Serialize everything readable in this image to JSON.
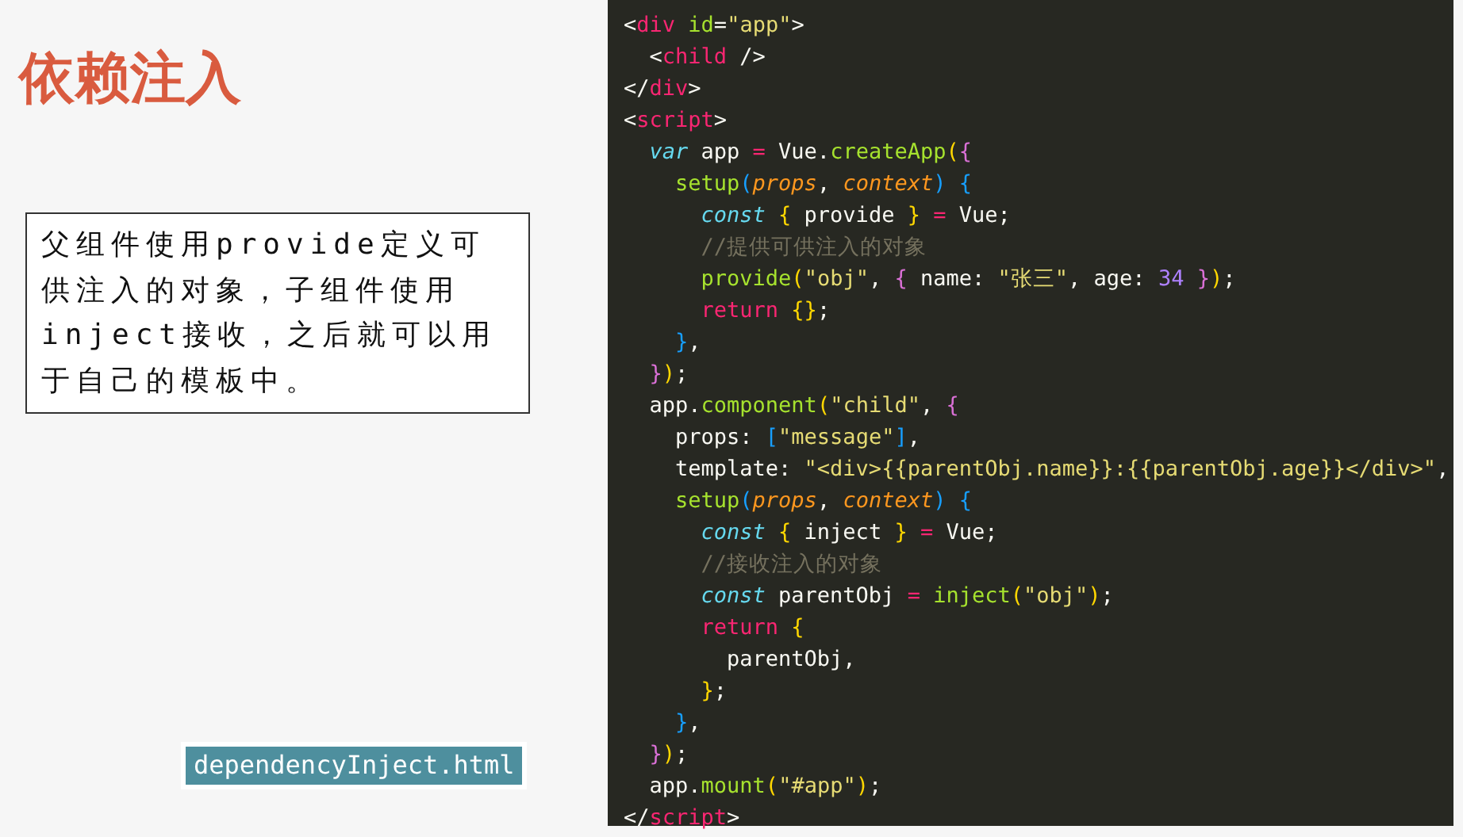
{
  "slide": {
    "title": "依赖注入",
    "description": "父组件使用provide定义可供注入的对象，子组件使用inject接收，之后就可以用于自己的模板中。",
    "file_label": "dependencyInject.html"
  },
  "code_lines": [
    [
      {
        "text": "<",
        "kind": "plain"
      },
      {
        "text": "div",
        "kind": "tag"
      },
      {
        "text": " id",
        "kind": "attr"
      },
      {
        "text": "=",
        "kind": "plain"
      },
      {
        "text": "\"app\"",
        "kind": "string"
      },
      {
        "text": ">",
        "kind": "plain"
      }
    ],
    [
      {
        "text": "  <",
        "kind": "plain"
      },
      {
        "text": "child",
        "kind": "tag"
      },
      {
        "text": " />",
        "kind": "plain"
      }
    ],
    [
      {
        "text": "</",
        "kind": "plain"
      },
      {
        "text": "div",
        "kind": "tag"
      },
      {
        "text": ">",
        "kind": "plain"
      }
    ],
    [
      {
        "text": "<",
        "kind": "plain"
      },
      {
        "text": "script",
        "kind": "tag"
      },
      {
        "text": ">",
        "kind": "plain"
      }
    ],
    [
      {
        "text": "  var",
        "kind": "storage"
      },
      {
        "text": " app ",
        "kind": "plain"
      },
      {
        "text": "=",
        "kind": "operator"
      },
      {
        "text": " Vue.",
        "kind": "plain"
      },
      {
        "text": "createApp",
        "kind": "function"
      },
      {
        "text": "(",
        "kind": "bracket1"
      },
      {
        "text": "{",
        "kind": "bracket2"
      }
    ],
    [
      {
        "text": "    setup",
        "kind": "function"
      },
      {
        "text": "(",
        "kind": "bracket3"
      },
      {
        "text": "props",
        "kind": "param"
      },
      {
        "text": ", ",
        "kind": "plain"
      },
      {
        "text": "context",
        "kind": "param"
      },
      {
        "text": ")",
        "kind": "bracket3"
      },
      {
        "text": " {",
        "kind": "bracket3"
      }
    ],
    [
      {
        "text": "      const",
        "kind": "storage"
      },
      {
        "text": " {",
        "kind": "bracket1"
      },
      {
        "text": " provide ",
        "kind": "plain"
      },
      {
        "text": "}",
        "kind": "bracket1"
      },
      {
        "text": " =",
        "kind": "operator"
      },
      {
        "text": " Vue;",
        "kind": "plain"
      }
    ],
    [
      {
        "text": "      //提供可供注入的对象",
        "kind": "comment"
      }
    ],
    [
      {
        "text": "      provide",
        "kind": "function"
      },
      {
        "text": "(",
        "kind": "bracket1"
      },
      {
        "text": "\"obj\"",
        "kind": "string"
      },
      {
        "text": ", ",
        "kind": "plain"
      },
      {
        "text": "{",
        "kind": "bracket2"
      },
      {
        "text": " name: ",
        "kind": "plain"
      },
      {
        "text": "\"张三\"",
        "kind": "string"
      },
      {
        "text": ", age: ",
        "kind": "plain"
      },
      {
        "text": "34",
        "kind": "number"
      },
      {
        "text": " }",
        "kind": "bracket2"
      },
      {
        "text": ")",
        "kind": "bracket1"
      },
      {
        "text": ";",
        "kind": "plain"
      }
    ],
    [
      {
        "text": "      return",
        "kind": "operator"
      },
      {
        "text": " {}",
        "kind": "bracket1"
      },
      {
        "text": ";",
        "kind": "plain"
      }
    ],
    [
      {
        "text": "    }",
        "kind": "bracket3"
      },
      {
        "text": ",",
        "kind": "plain"
      }
    ],
    [
      {
        "text": "  }",
        "kind": "bracket2"
      },
      {
        "text": ")",
        "kind": "bracket1"
      },
      {
        "text": ";",
        "kind": "plain"
      }
    ],
    [
      {
        "text": "  app.",
        "kind": "plain"
      },
      {
        "text": "component",
        "kind": "function"
      },
      {
        "text": "(",
        "kind": "bracket1"
      },
      {
        "text": "\"child\"",
        "kind": "string"
      },
      {
        "text": ", ",
        "kind": "plain"
      },
      {
        "text": "{",
        "kind": "bracket2"
      }
    ],
    [
      {
        "text": "    props: ",
        "kind": "plain"
      },
      {
        "text": "[",
        "kind": "bracket3"
      },
      {
        "text": "\"message\"",
        "kind": "string"
      },
      {
        "text": "]",
        "kind": "bracket3"
      },
      {
        "text": ",",
        "kind": "plain"
      }
    ],
    [
      {
        "text": "    template: ",
        "kind": "plain"
      },
      {
        "text": "\"<div>{{parentObj.name}}:{{parentObj.age}}</div>\"",
        "kind": "string"
      },
      {
        "text": ",",
        "kind": "plain"
      }
    ],
    [
      {
        "text": "    setup",
        "kind": "function"
      },
      {
        "text": "(",
        "kind": "bracket3"
      },
      {
        "text": "props",
        "kind": "param"
      },
      {
        "text": ", ",
        "kind": "plain"
      },
      {
        "text": "context",
        "kind": "param"
      },
      {
        "text": ")",
        "kind": "bracket3"
      },
      {
        "text": " {",
        "kind": "bracket3"
      }
    ],
    [
      {
        "text": "      const",
        "kind": "storage"
      },
      {
        "text": " {",
        "kind": "bracket1"
      },
      {
        "text": " inject ",
        "kind": "plain"
      },
      {
        "text": "}",
        "kind": "bracket1"
      },
      {
        "text": " =",
        "kind": "operator"
      },
      {
        "text": " Vue;",
        "kind": "plain"
      }
    ],
    [
      {
        "text": "      //接收注入的对象",
        "kind": "comment"
      }
    ],
    [
      {
        "text": "      const",
        "kind": "storage"
      },
      {
        "text": " parentObj ",
        "kind": "plain"
      },
      {
        "text": "=",
        "kind": "operator"
      },
      {
        "text": " inject",
        "kind": "function"
      },
      {
        "text": "(",
        "kind": "bracket1"
      },
      {
        "text": "\"obj\"",
        "kind": "string"
      },
      {
        "text": ")",
        "kind": "bracket1"
      },
      {
        "text": ";",
        "kind": "plain"
      }
    ],
    [
      {
        "text": "      return",
        "kind": "operator"
      },
      {
        "text": " {",
        "kind": "bracket1"
      }
    ],
    [
      {
        "text": "        parentObj,",
        "kind": "plain"
      }
    ],
    [
      {
        "text": "      }",
        "kind": "bracket1"
      },
      {
        "text": ";",
        "kind": "plain"
      }
    ],
    [
      {
        "text": "    }",
        "kind": "bracket3"
      },
      {
        "text": ",",
        "kind": "plain"
      }
    ],
    [
      {
        "text": "  }",
        "kind": "bracket2"
      },
      {
        "text": ")",
        "kind": "bracket1"
      },
      {
        "text": ";",
        "kind": "plain"
      }
    ],
    [
      {
        "text": "  app.",
        "kind": "plain"
      },
      {
        "text": "mount",
        "kind": "function"
      },
      {
        "text": "(",
        "kind": "bracket1"
      },
      {
        "text": "\"#app\"",
        "kind": "string"
      },
      {
        "text": ")",
        "kind": "bracket1"
      },
      {
        "text": ";",
        "kind": "plain"
      }
    ],
    [
      {
        "text": "</",
        "kind": "plain"
      },
      {
        "text": "script",
        "kind": "tag"
      },
      {
        "text": ">",
        "kind": "plain"
      }
    ]
  ]
}
